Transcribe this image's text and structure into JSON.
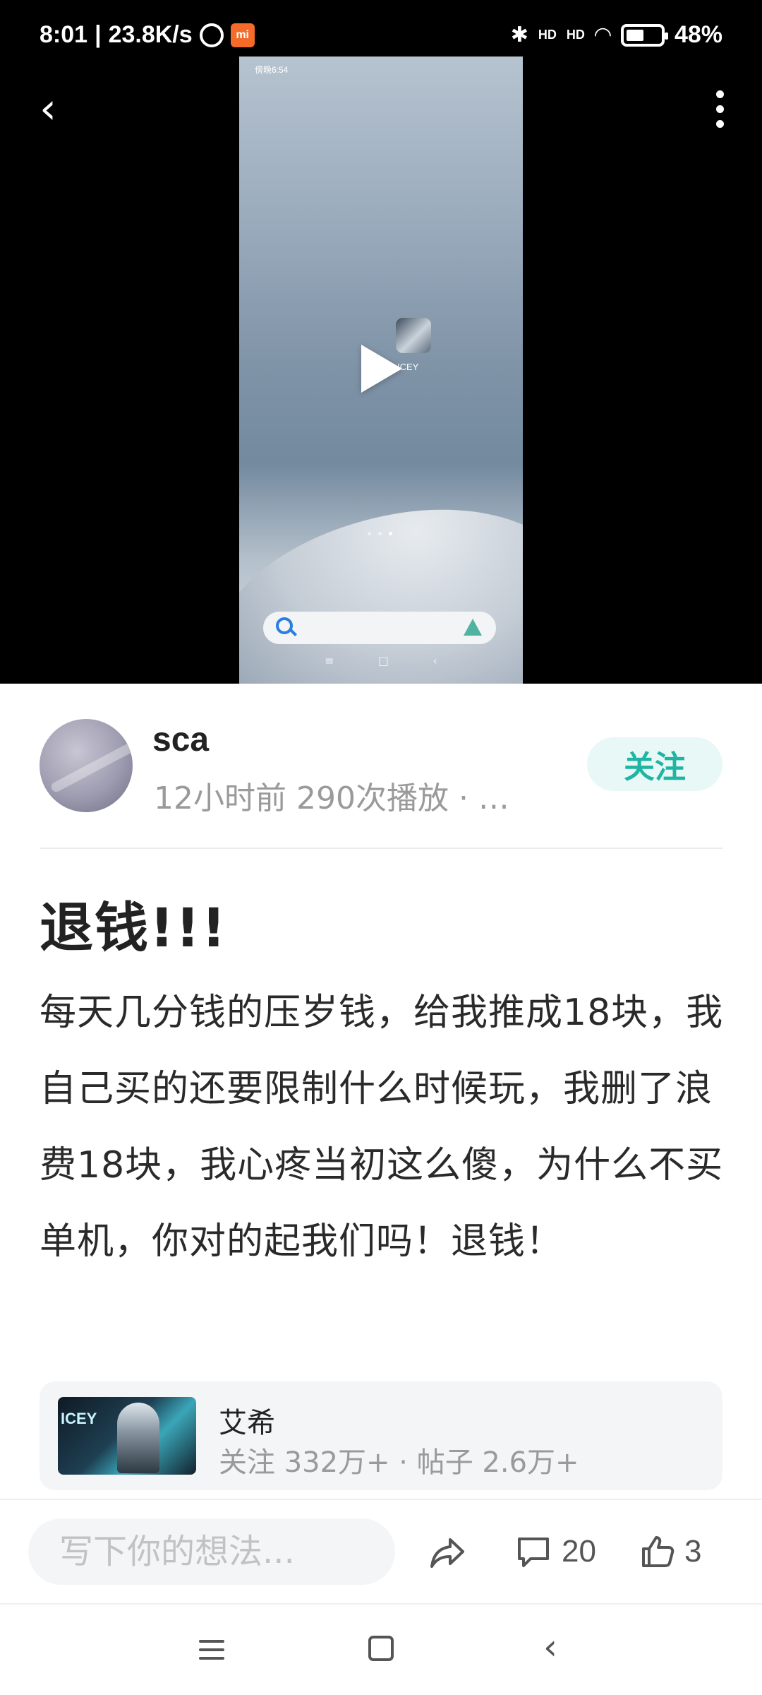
{
  "status_bar": {
    "time": "8:01",
    "separator": "|",
    "speed": "23.8K/s",
    "mi_badge": "mi",
    "hd_label_1": "HD",
    "hd_label_2": "HD",
    "battery_percent": "48%"
  },
  "video": {
    "preview_time": "傍晚6:54",
    "preview_app_label": "ICEY",
    "is_playing": false
  },
  "author": {
    "name": "sca",
    "meta": "12小时前  290次播放  ·  …",
    "follow_label": "关注"
  },
  "post": {
    "title": "退钱!!!",
    "body": "每天几分钱的压岁钱，给我推成18块，我自己买的还要限制什么时候玩，我删了浪费18块，我心疼当初这么傻，为什么不买单机，你对的起我们吗！退钱！"
  },
  "game_card": {
    "thumb_text": "ICEY",
    "name": "艾希",
    "meta": "关注 332万+  ·  帖子 2.6万+"
  },
  "actions": {
    "comment_placeholder": "写下你的想法...",
    "comment_count": "20",
    "like_count": "3"
  },
  "colors": {
    "accent": "#20b4a3",
    "follow_bg": "#e8f8f6",
    "card_bg": "#f4f5f7",
    "meta_gray": "#9a9a9a"
  },
  "icons": {
    "back": "back-arrow-icon",
    "more": "more-vertical-icon",
    "play": "play-icon",
    "share": "share-icon",
    "comment": "comment-icon",
    "like": "thumbs-up-icon"
  }
}
